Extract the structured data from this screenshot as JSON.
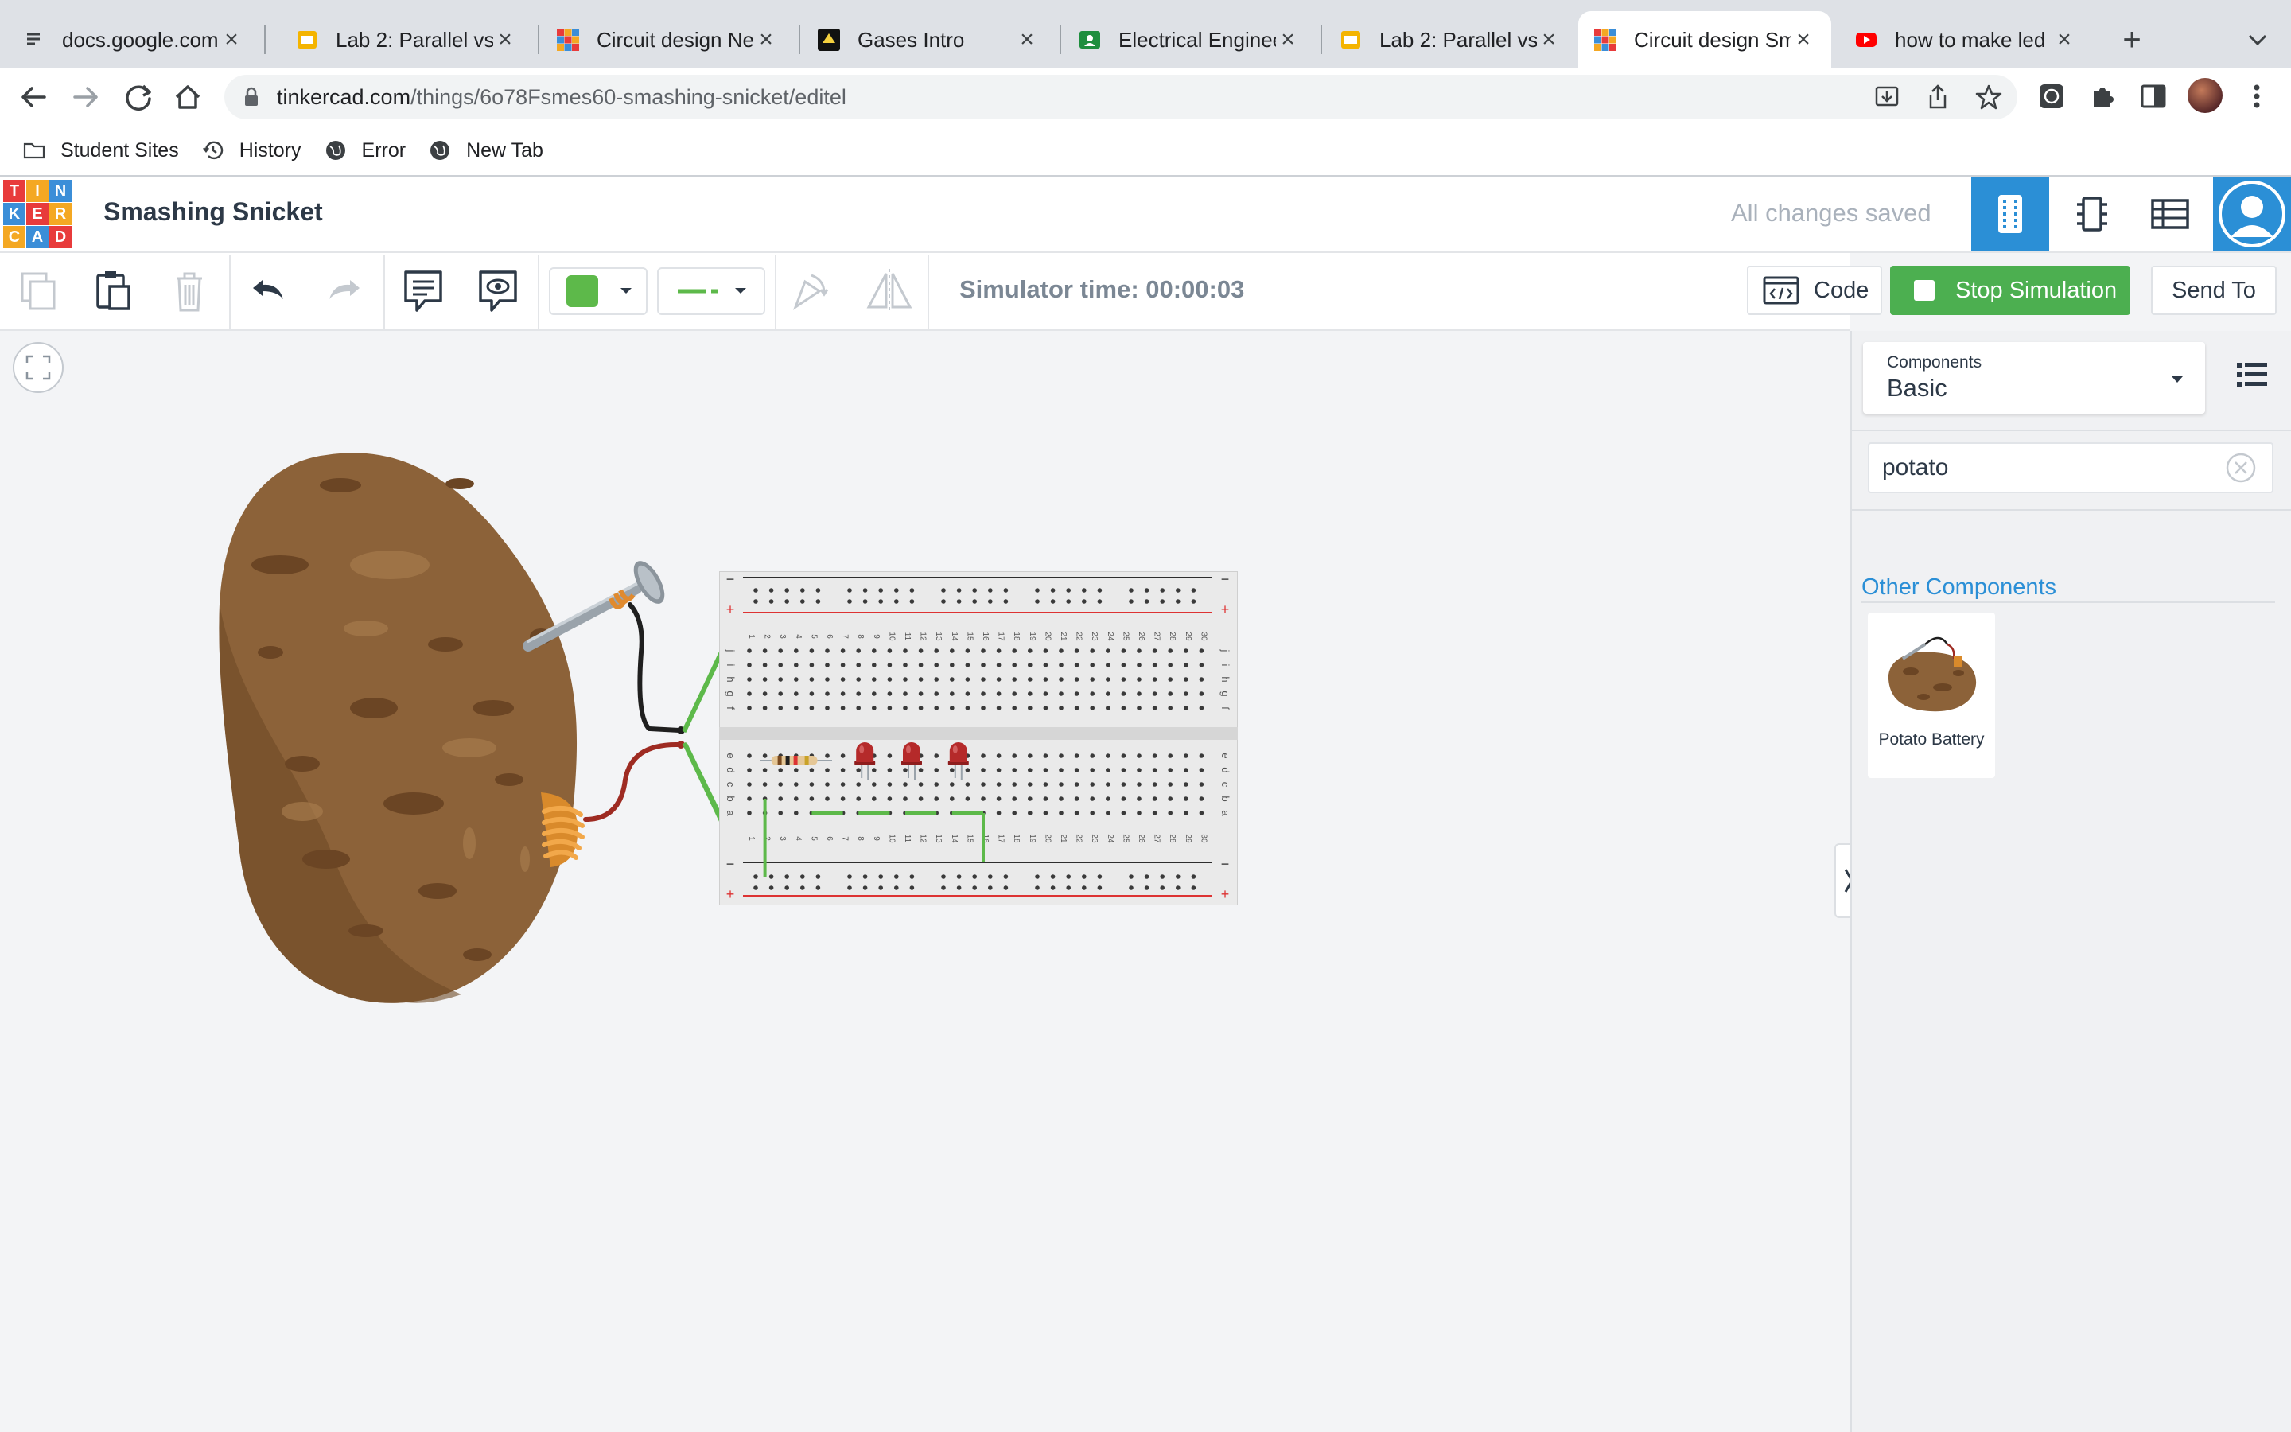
{
  "browser": {
    "tabs": [
      {
        "title": "docs.google.com",
        "icon": "google-docs-icon",
        "active": false
      },
      {
        "title": "Lab 2: Parallel vs",
        "icon": "google-slides-icon",
        "active": false
      },
      {
        "title": "Circuit design Ne",
        "icon": "tinkercad-icon",
        "active": false
      },
      {
        "title": "Gases Intro",
        "icon": "phet-icon",
        "active": false
      },
      {
        "title": "Electrical Enginee",
        "icon": "google-classroom-icon",
        "active": false
      },
      {
        "title": "Lab 2: Parallel vs",
        "icon": "google-slides-icon",
        "active": false
      },
      {
        "title": "Circuit design Sm",
        "icon": "tinkercad-icon",
        "active": true
      },
      {
        "title": "how to make led",
        "icon": "youtube-icon",
        "active": false
      }
    ],
    "new_tab_label": "+",
    "url_domain": "tinkercad.com",
    "url_path": "/things/6o78Fsmes60-smashing-snicket/editel",
    "bookmarks": [
      {
        "label": "Student Sites",
        "icon": "folder-icon"
      },
      {
        "label": "History",
        "icon": "history-icon"
      },
      {
        "label": "Error",
        "icon": "globe-icon"
      },
      {
        "label": "New Tab",
        "icon": "globe-icon"
      }
    ]
  },
  "app": {
    "logo_letters": [
      "T",
      "I",
      "N",
      "K",
      "E",
      "R",
      "C",
      "A",
      "D"
    ],
    "logo_colors": [
      "#e83b3b",
      "#f4a823",
      "#3b8ed8",
      "#3b8ed8",
      "#e83b3b",
      "#f4a823",
      "#f4a823",
      "#3b8ed8",
      "#e83b3b"
    ],
    "project_name": "Smashing Snicket",
    "save_status": "All changes saved",
    "accent": "#2b8fd6",
    "toolbar": {
      "simulator_time": "Simulator time: 00:00:03",
      "code_label": "Code",
      "stop_label": "Stop Simulation",
      "send_label": "Send To",
      "fill_color": "#5db94a",
      "stop_color": "#4caf50"
    },
    "panel": {
      "components_label": "Components",
      "components_value": "Basic",
      "search_value": "potato",
      "section_title": "Other Components",
      "component_name": "Potato Battery"
    },
    "breadboard": {
      "column_numbers": [
        "1",
        "2",
        "3",
        "4",
        "5",
        "6",
        "7",
        "8",
        "9",
        "10",
        "11",
        "12",
        "13",
        "14",
        "15",
        "16",
        "17",
        "18",
        "19",
        "20",
        "21",
        "22",
        "23",
        "24",
        "25",
        "26",
        "27",
        "28",
        "29",
        "30"
      ],
      "row_letters_top": [
        "j",
        "i",
        "h",
        "g",
        "f"
      ],
      "row_letters_bottom": [
        "e",
        "d",
        "c",
        "b",
        "a"
      ],
      "rail_minus": "−",
      "rail_plus": "+"
    }
  }
}
